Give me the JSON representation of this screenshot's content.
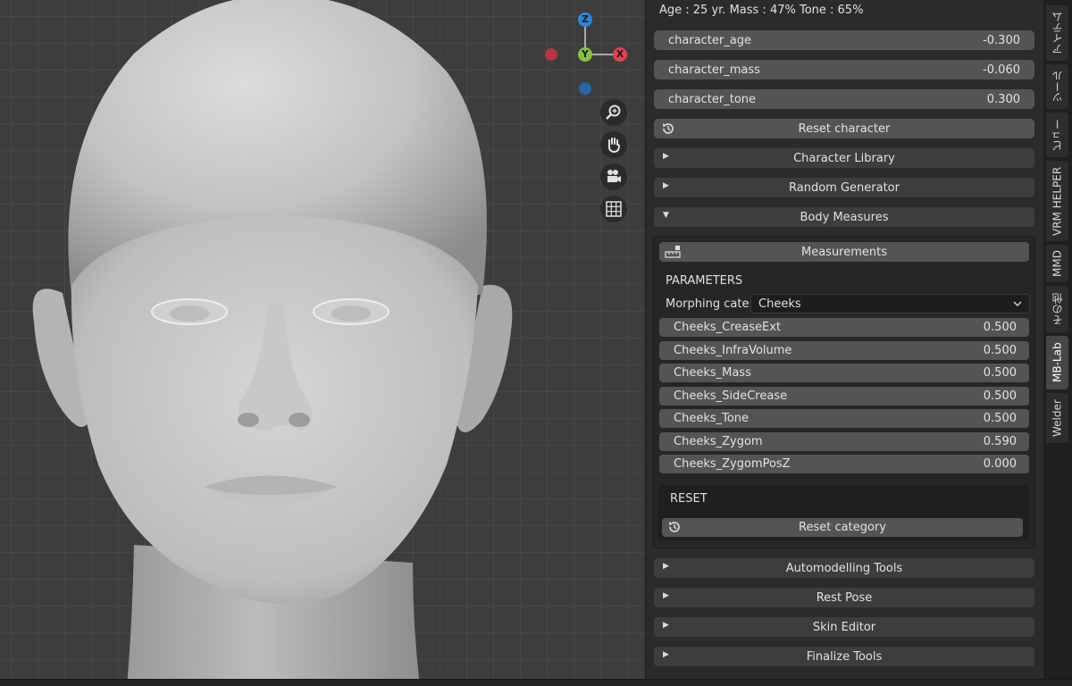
{
  "viewport": {
    "gizmo": {
      "z_label": "Z",
      "y_label": "Y",
      "x_label": "X",
      "colors": {
        "x": "#e8404d",
        "y": "#86c43c",
        "z": "#2d86d8"
      }
    },
    "nav_icons": [
      "zoom-icon",
      "pan-hand-icon",
      "camera-icon",
      "grid-icon"
    ]
  },
  "panel": {
    "info": "Age : 25 yr.  Mass : 47%  Tone : 65%",
    "character_sliders": [
      {
        "label": "character_age",
        "value": "-0.300"
      },
      {
        "label": "character_mass",
        "value": "-0.060"
      },
      {
        "label": "character_tone",
        "value": "0.300"
      }
    ],
    "reset_character": "Reset character",
    "sections_top": [
      {
        "label": "Character Library",
        "arrow": "▶"
      },
      {
        "label": "Random Generator",
        "arrow": "▶"
      }
    ],
    "body_measures": {
      "label": "Body Measures",
      "arrow": "▼",
      "measurements_button": "Measurements",
      "parameters_label": "PARAMETERS",
      "morphing_label": "Morphing cate..",
      "morphing_value": "Cheeks",
      "params": [
        {
          "label": "Cheeks_CreaseExt",
          "value": "0.500"
        },
        {
          "label": "Cheeks_InfraVolume",
          "value": "0.500"
        },
        {
          "label": "Cheeks_Mass",
          "value": "0.500"
        },
        {
          "label": "Cheeks_SideCrease",
          "value": "0.500"
        },
        {
          "label": "Cheeks_Tone",
          "value": "0.500"
        },
        {
          "label": "Cheeks_Zygom",
          "value": "0.590"
        },
        {
          "label": "Cheeks_ZygomPosZ",
          "value": "0.000"
        }
      ],
      "reset_label": "RESET",
      "reset_category": "Reset category"
    },
    "sections_bottom": [
      {
        "label": "Automodelling Tools",
        "arrow": "▶"
      },
      {
        "label": "Rest Pose",
        "arrow": "▶"
      },
      {
        "label": "Skin Editor",
        "arrow": "▶"
      },
      {
        "label": "Finalize Tools",
        "arrow": "▶"
      }
    ]
  },
  "tabs": [
    {
      "label": "アイテム",
      "active": false
    },
    {
      "label": "ツール",
      "active": false
    },
    {
      "label": "ビュー",
      "active": false
    },
    {
      "label": "VRM HELPER",
      "active": false
    },
    {
      "label": "MMD",
      "active": false
    },
    {
      "label": "その他",
      "active": false
    },
    {
      "label": "MB-Lab",
      "active": true
    },
    {
      "label": "Welder",
      "active": false
    }
  ]
}
